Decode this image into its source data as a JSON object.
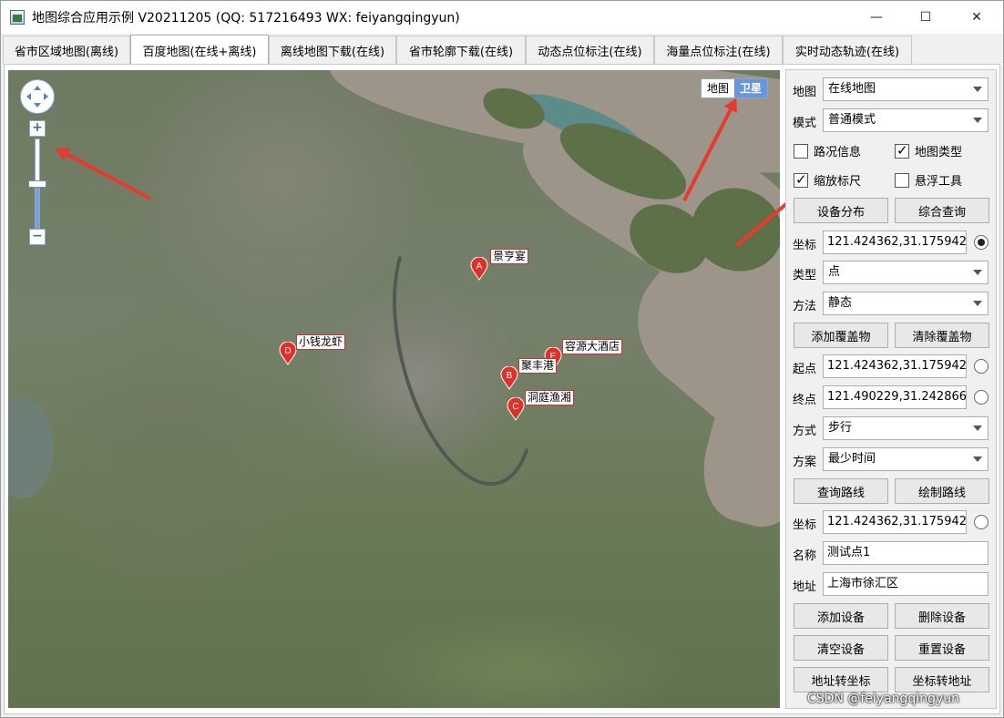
{
  "window": {
    "title": "地图综合应用示例 V20211205 (QQ: 517216493 WX: feiyangqingyun)",
    "minimize_glyph": "—",
    "maximize_glyph": "☐",
    "close_glyph": "✕"
  },
  "tabs": [
    {
      "label": "省市区域地图(离线)"
    },
    {
      "label": "百度地图(在线+离线)"
    },
    {
      "label": "离线地图下载(在线)"
    },
    {
      "label": "省市轮廓下载(在线)"
    },
    {
      "label": "动态点位标注(在线)"
    },
    {
      "label": "海量点位标注(在线)"
    },
    {
      "label": "实时动态轨迹(在线)"
    }
  ],
  "active_tab": "百度地图(在线+离线)",
  "map": {
    "type_options": [
      "地图",
      "卫星"
    ],
    "type_selected": "卫星",
    "zoom_in": "+",
    "zoom_out": "−",
    "zoom_level_fraction": 0.5,
    "markers": [
      {
        "letter": "A",
        "name": "景亨宴"
      },
      {
        "letter": "D",
        "name": "小钱龙虾"
      },
      {
        "letter": "E",
        "name": "容源大酒店"
      },
      {
        "letter": "B",
        "name": "聚丰港"
      },
      {
        "letter": "C",
        "name": "洞庭渔湘"
      }
    ],
    "marker_color": "#e0302a",
    "annotation_arrow_color": "#e63a2e"
  },
  "panel": {
    "map_label": "地图",
    "map_value": "在线地图",
    "mode_label": "模式",
    "mode_value": "普通模式",
    "checks": {
      "traffic": {
        "label": "路况信息",
        "checked": false
      },
      "maptype": {
        "label": "地图类型",
        "checked": true
      },
      "scale": {
        "label": "缩放标尺",
        "checked": true
      },
      "float_tools": {
        "label": "悬浮工具",
        "checked": false
      }
    },
    "device_dist_btn": "设备分布",
    "query_btn": "综合查询",
    "coord_label": "坐标",
    "coord_value": "121.424362,31.175942",
    "type_label": "类型",
    "type_value": "点",
    "method_label": "方法",
    "method_value": "静态",
    "add_overlay_btn": "添加覆盖物",
    "clear_overlay_btn": "清除覆盖物",
    "start_label": "起点",
    "start_value": "121.424362,31.175942",
    "end_label": "终点",
    "end_value": "121.490229,31.242866",
    "way_label": "方式",
    "way_value": "步行",
    "plan_label": "方案",
    "plan_value": "最少时间",
    "query_route_btn": "查询路线",
    "draw_route_btn": "绘制路线",
    "coord2_label": "坐标",
    "coord2_value": "121.424362,31.175942",
    "name_label": "名称",
    "name_value": "测试点1",
    "addr_label": "地址",
    "addr_value": "上海市徐汇区",
    "add_device_btn": "添加设备",
    "del_device_btn": "删除设备",
    "clear_device_btn": "清空设备",
    "reset_device_btn": "重置设备",
    "addr2coord_btn": "地址转坐标",
    "coord2addr_btn": "坐标转地址"
  },
  "watermark": "CSDN @feiyangqingyun"
}
